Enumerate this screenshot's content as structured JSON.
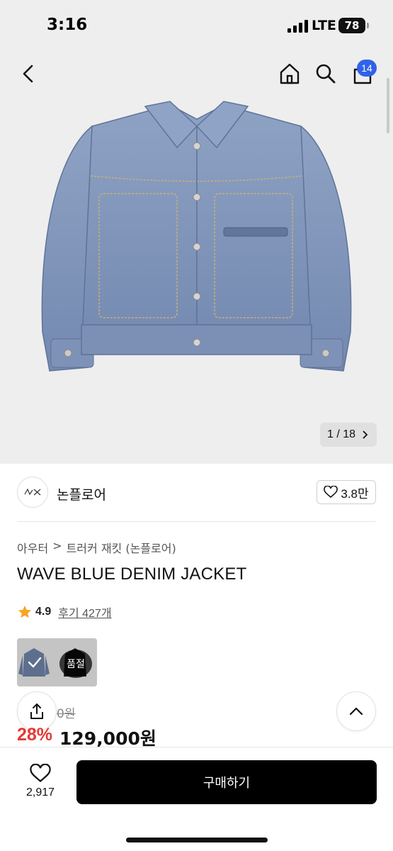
{
  "status_bar": {
    "time": "3:16",
    "network": "LTE",
    "battery": "78"
  },
  "nav": {
    "cart_count": "14",
    "icons": [
      "back-arrow-icon",
      "home-icon",
      "search-icon",
      "cart-icon"
    ]
  },
  "gallery": {
    "counter": "1 / 18",
    "image": "blue-denim-jacket-photo"
  },
  "brand": {
    "name": "논플로어",
    "likes": "3.8만"
  },
  "product": {
    "breadcrumb": [
      "아우터",
      "트러커 재킷 (논플로어)"
    ],
    "title": "WAVE BLUE DENIM JACKET",
    "rating": "4.9",
    "reviews": "후기 427개",
    "sold_out_label": "품절",
    "original_price": "0원",
    "discount": "28%",
    "price": "129,000원"
  },
  "bottom": {
    "wish_count": "2,917",
    "buy_label": "구매하기"
  },
  "colors": {
    "accent_blue": "#2f63e8",
    "discount_red": "#e53935",
    "rating_star": "#f5a623",
    "buy_button": "#000000"
  }
}
